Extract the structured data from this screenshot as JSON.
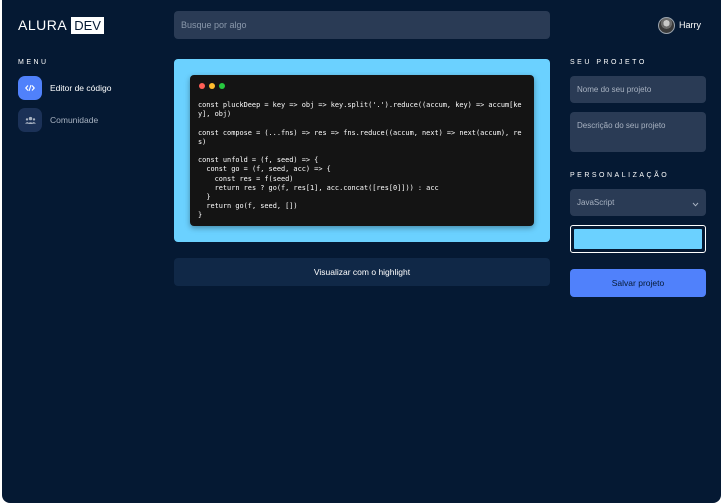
{
  "header": {
    "logo_text": "ALURA",
    "logo_badge": "DEV",
    "search_placeholder": "Busque por algo",
    "user_name": "Harry"
  },
  "menu": {
    "title": "MENU",
    "items": [
      {
        "label": "Editor de código",
        "icon": "code-icon",
        "active": true
      },
      {
        "label": "Comunidade",
        "icon": "users-icon",
        "active": false
      }
    ]
  },
  "editor": {
    "frame_color": "#6bd1ff",
    "code": "const pluckDeep = key => obj => key.split('.').reduce((accum, key) => accum[key], obj)\n\nconst compose = (...fns) => res => fns.reduce((accum, next) => next(accum), res)\n\nconst unfold = (f, seed) => {\n  const go = (f, seed, acc) => {\n    const res = f(seed)\n    return res ? go(f, res[1], acc.concat([res[0]])) : acc\n  }\n  return go(f, seed, [])\n}",
    "highlight_button": "Visualizar com o highlight"
  },
  "project": {
    "title": "SEU PROJETO",
    "name_placeholder": "Nome do seu projeto",
    "description_placeholder": "Descrição do seu projeto"
  },
  "customization": {
    "title": "PERSONALIZAÇÃO",
    "language": "JavaScript",
    "color": "#6bd1ff"
  },
  "save_button": "Salvar projeto",
  "colors": {
    "background": "#051933",
    "accent": "#5081fb",
    "field": "#2a3b55",
    "highlight": "#6bd1ff"
  }
}
